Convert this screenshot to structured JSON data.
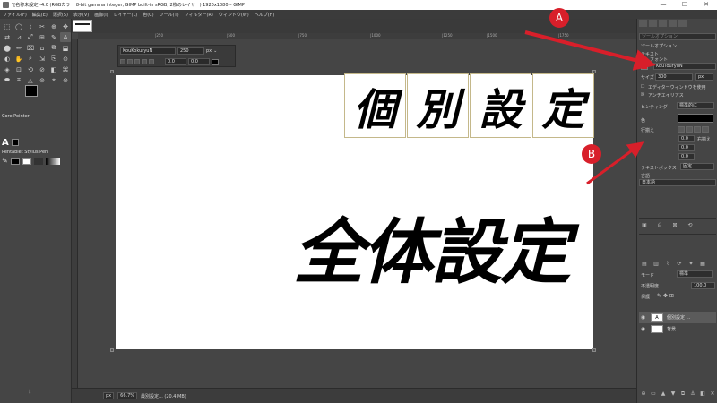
{
  "window": {
    "title": "\"[名称未設定]-4.0 (RGBカラー 8-bit gamma integer, GIMP built-in sRGB, 2枚のレイヤー) 1920x1080 – GIMP",
    "minimize": "—",
    "maximize": "☐",
    "close": "✕"
  },
  "menu": [
    "ファイル(F)",
    "編集(E)",
    "選択(S)",
    "表示(V)",
    "画像(I)",
    "レイヤー(L)",
    "色(C)",
    "ツール(T)",
    "フィルター(R)",
    "ウィンドウ(W)",
    "ヘルプ(H)"
  ],
  "toolbox": {
    "tools": [
      "⬚",
      "◯",
      "⌇",
      "✂",
      "⊕",
      "✥",
      "⇄",
      "⊿",
      "⤢",
      "⊞",
      "✎",
      "A",
      "⬤",
      "✏",
      "⌧",
      "⌂",
      "⧉",
      "⬓",
      "◐",
      "✋",
      "⌕",
      "⇲",
      "⎘",
      "⊙",
      "◈",
      "⊡",
      "⟲",
      "⊘",
      "◧",
      "⌘",
      "⬬",
      "⌗",
      "◬",
      "⊚",
      "⌖",
      "⊛"
    ],
    "active_tool_index": 11,
    "font_section": "Core Pointer",
    "font_glyph": "A",
    "brush_section": "Pentablet  Stylus Pen"
  },
  "ruler_labels": [
    "|250",
    "|500",
    "|750",
    "|1000",
    "|1250",
    "|1500",
    "|1750"
  ],
  "text_float": {
    "font": "KouKokuryuN",
    "size": "250",
    "unit": "px",
    "offset_x": "0.0",
    "offset_y": "0.0"
  },
  "canvas": {
    "kanji_boxes": [
      "個",
      "別",
      "設",
      "定"
    ],
    "big_text": "全体設定"
  },
  "annotations": {
    "a": "A",
    "b": "B"
  },
  "status": {
    "unit": "px",
    "zoom": "66.7%",
    "info": "最別設定... (20.4 MB)"
  },
  "dock": {
    "search_placeholder": "ツールオプション",
    "tool_options_title": "ツールオプション",
    "text_label": "テキスト",
    "font_label": "フォント",
    "font_value": "KouTouryuN",
    "size_label": "サイズ",
    "size_value": "300",
    "size_unit": "px",
    "editor_label": "エディターウィンドウを使用",
    "antialias_label": "アンチエイリアス",
    "hinting_label": "ヒンティング",
    "hinting_value": "標準的に",
    "color_label": "色",
    "justify_label": "行揃え",
    "indent_value": "0.0",
    "line_spacing_value": "0.0",
    "letter_spacing_value": "0.0",
    "right_align_label": "右揃え",
    "textbox_label": "テキストボックス",
    "textbox_value": "固定",
    "language_label": "言語",
    "language_value": "日本語",
    "mode_label": "モード",
    "mode_value": "標準",
    "opacity_label": "不透明度",
    "opacity_value": "100.0",
    "lock_label": "保護",
    "layers": [
      "個別設定 ...",
      "背景"
    ]
  },
  "colors": {
    "annotation": "#d81f2a",
    "box_border": "#c4b88a"
  }
}
